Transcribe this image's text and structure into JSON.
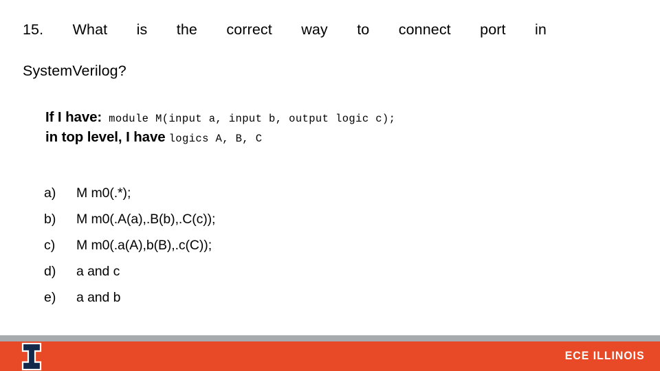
{
  "slide": {
    "question": {
      "line1": "15.  What  is  the  correct  way  to  connect  port  in",
      "line2": "SystemVerilog?",
      "number": "15.",
      "full_text": "15. What is the correct way to connect port in SystemVerilog?"
    },
    "premise": {
      "label1": "If I have:",
      "code1": "module M(input a, input b, output logic c);",
      "label2": "in top level, I have",
      "code2": "logics A, B, C"
    },
    "options": [
      {
        "marker": "a)",
        "text": "M m0(.*);"
      },
      {
        "marker": "b)",
        "text": "M m0(.A(a),.B(b),.C(c));"
      },
      {
        "marker": "c)",
        "text": "M m0(.a(A),b(B),.c(C));"
      },
      {
        "marker": "d)",
        "text": "a and c"
      },
      {
        "marker": "e)",
        "text": "a and b"
      }
    ],
    "footer": {
      "wordmark": "ECE ILLINOIS",
      "logo_name": "illinois-block-i-logo",
      "orange": "#e84a27",
      "gray": "#a7abad",
      "navy": "#13294b",
      "white": "#ffffff"
    }
  }
}
